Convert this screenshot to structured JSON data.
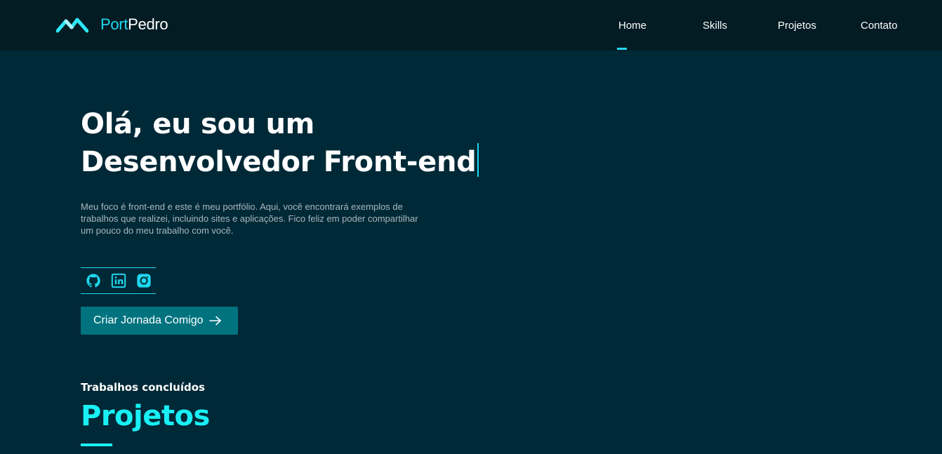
{
  "brand": {
    "logo_icon": "mountain-logo-icon",
    "name_accent": "Port",
    "name_rest": "Pedro"
  },
  "nav": {
    "items": [
      {
        "label": "Home",
        "active": true
      },
      {
        "label": "Skills",
        "active": false
      },
      {
        "label": "Projetos",
        "active": false
      },
      {
        "label": "Contato",
        "active": false
      }
    ]
  },
  "hero": {
    "title_line1": "Olá, eu sou um",
    "title_line2": "Desenvolvedor Front-end",
    "description": "Meu foco é front-end e este é meu portfólio. Aqui, você encontrará exemplos de trabalhos que realizei, incluindo sites e aplicações. Fico feliz em poder compartilhar um pouco do meu trabalho com você.",
    "social": [
      {
        "icon": "github-icon"
      },
      {
        "icon": "linkedin-icon"
      },
      {
        "icon": "instagram-icon"
      }
    ],
    "cta_label": "Criar Jornada Comigo",
    "cta_icon": "arrow-right-icon"
  },
  "projects": {
    "subtitle": "Trabalhos concluídos",
    "title": "Projetos"
  },
  "colors": {
    "background": "#002937",
    "navbar": "#031b23",
    "accent": "#1fd8f0",
    "heading_accent": "#19f0f5",
    "button": "#00737f",
    "muted_text": "#a9b8bf"
  }
}
